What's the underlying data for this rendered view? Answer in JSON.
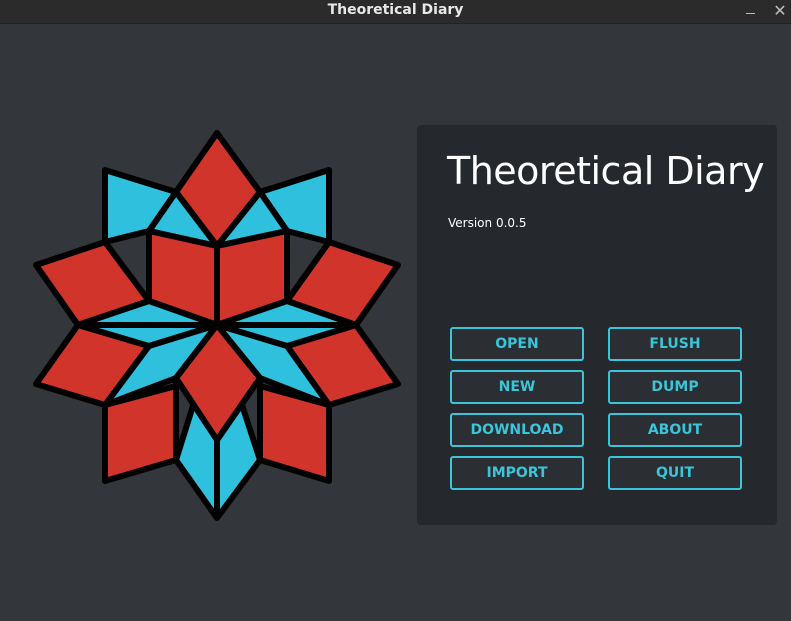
{
  "window": {
    "title": "Theoretical Diary",
    "minimize_icon": "minimize-icon",
    "close_icon": "close-icon",
    "close_glyph": "✕"
  },
  "logo": {
    "icon": "star-mosaic-logo",
    "colors": {
      "red": "#d1342a",
      "cyan": "#2ec0dc",
      "outline": "#000000"
    }
  },
  "panel": {
    "app_title": "Theoretical Diary",
    "version": "Version 0.0.5"
  },
  "buttons": {
    "open": "OPEN",
    "flush": "FLUSH",
    "new": "NEW",
    "dump": "DUMP",
    "download": "DOWNLOAD",
    "about": "ABOUT",
    "import": "IMPORT",
    "quit": "QUIT"
  },
  "colors": {
    "background": "#33363b",
    "panel": "#25282c",
    "accent": "#3cc4d8",
    "titlebar": "#2b2b2b"
  }
}
